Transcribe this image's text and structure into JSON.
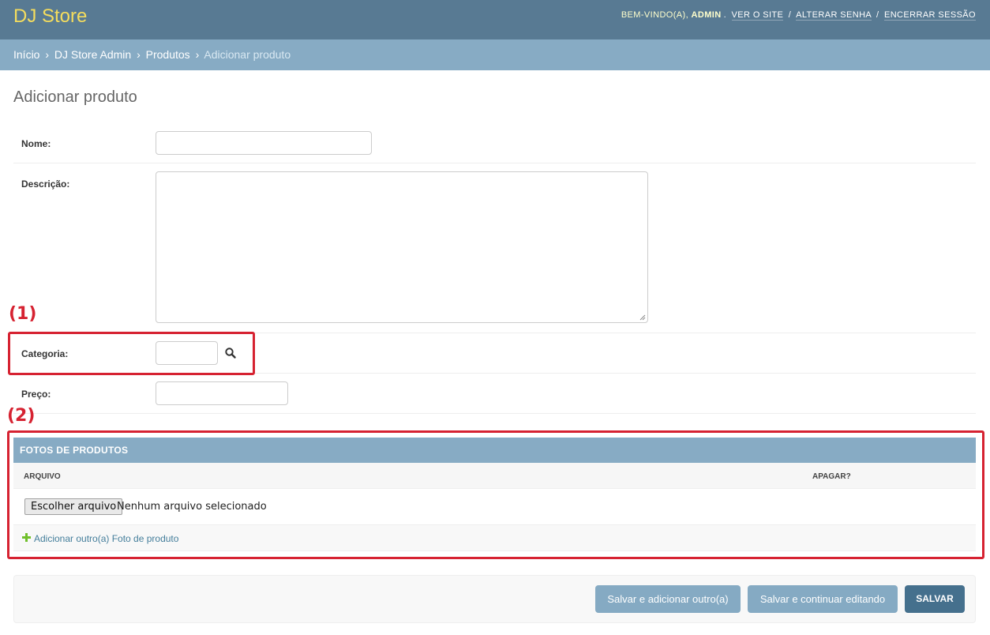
{
  "header": {
    "brand": "DJ Store",
    "welcome": "BEM-VINDO(A),",
    "username": "ADMIN",
    "links": [
      "VER O SITE",
      "ALTERAR SENHA",
      "ENCERRAR SESSÃO"
    ]
  },
  "breadcrumbs": {
    "items": [
      "Início",
      "DJ Store Admin",
      "Produtos"
    ],
    "current": "Adicionar produto",
    "separator": "›"
  },
  "page": {
    "title": "Adicionar produto"
  },
  "form": {
    "nome_label": "Nome:",
    "nome_value": "",
    "descricao_label": "Descrição:",
    "descricao_value": "",
    "categoria_label": "Categoria:",
    "categoria_value": "",
    "preco_label": "Preço:",
    "preco_value": ""
  },
  "annotations": {
    "one": "(1)",
    "two": "(2)"
  },
  "inline": {
    "title": "FOTOS DE PRODUTOS",
    "col_arquivo": "ARQUIVO",
    "col_apagar": "APAGAR?",
    "file_button": "Escolher arquivo",
    "file_status": "Nenhum arquivo selecionado",
    "add_link": "Adicionar outro(a) Foto de produto"
  },
  "submit": {
    "add_another": "Salvar e adicionar outro(a)",
    "continue": "Salvar e continuar editando",
    "save": "SALVAR"
  },
  "colors": {
    "header_bg": "#587a93",
    "brand": "#f5dd5d",
    "breadcrumb_bg": "#87abc4",
    "annotation": "#d62231",
    "save_button": "#45708d"
  }
}
